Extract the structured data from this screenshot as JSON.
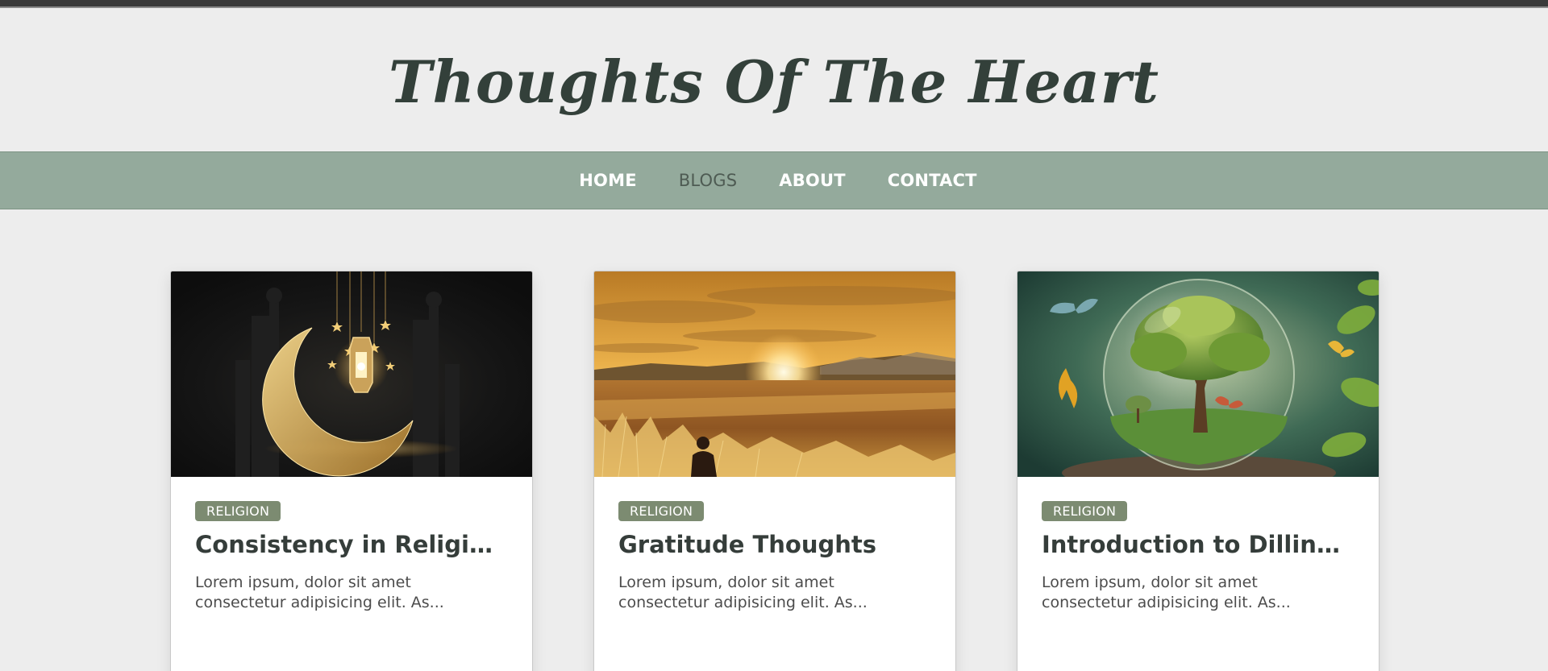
{
  "site": {
    "title": "Thoughts Of The Heart"
  },
  "nav": {
    "items": [
      {
        "label": "HOME",
        "active": false
      },
      {
        "label": "BLOGS",
        "active": true
      },
      {
        "label": "ABOUT",
        "active": false
      },
      {
        "label": "CONTACT",
        "active": false
      }
    ]
  },
  "colors": {
    "nav_background": "#94aa9c",
    "badge": "#7c8b71",
    "title_text": "#33403a",
    "page_background": "#ededed"
  },
  "posts": [
    {
      "category": "RELIGION",
      "title": "Consistency in Religious Practice",
      "excerpt_line1": "Lorem ipsum, dolor sit amet",
      "excerpt_line2": "consectetur adipisicing elit. As...",
      "image": "crescent-moon-lantern-image"
    },
    {
      "category": "RELIGION",
      "title": "Gratitude Thoughts",
      "excerpt_line1": "Lorem ipsum, dolor sit amet",
      "excerpt_line2": "consectetur adipisicing elit. As...",
      "image": "sunset-field-image"
    },
    {
      "category": "RELIGION",
      "title": "Introduction to Dillinger",
      "excerpt_line1": "Lorem ipsum, dolor sit amet",
      "excerpt_line2": "consectetur adipisicing elit. As...",
      "image": "tree-in-glass-sphere-image"
    }
  ]
}
